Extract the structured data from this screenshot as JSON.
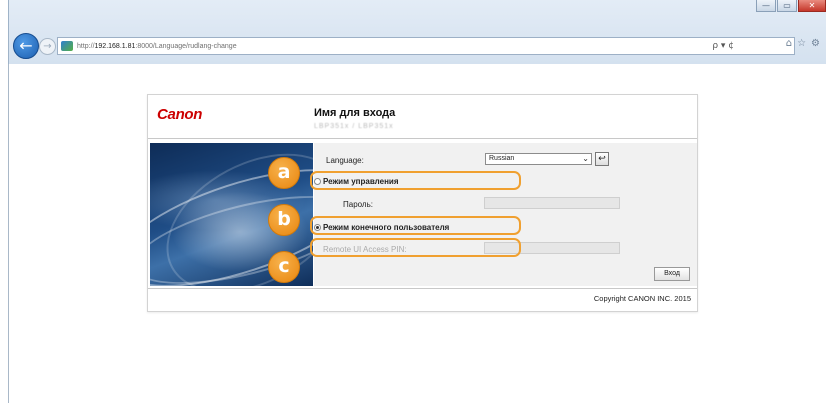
{
  "browser": {
    "url_prefix": "http://",
    "url_host": "192.168.1.81",
    "url_path": ":8000/Language/rudlang-change",
    "search_glyph": "ρ ▾ ¢",
    "window_buttons": [
      "—",
      "▭",
      "✕"
    ],
    "nav_icons": [
      "⌂",
      "☆",
      "⚙"
    ]
  },
  "page": {
    "logo_text": "Canon",
    "title": "Имя для входа",
    "device_name": "LBP351x / LBP351x",
    "form": {
      "language_label": "Language:",
      "language_selected": "Russian",
      "go_button_glyph": "↩",
      "admin_mode_label": "Режим управления",
      "password_label": "Пароль:",
      "user_mode_label": "Режим конечного пользователя",
      "pin_label": "Remote UI Access PIN:",
      "login_button": "Вход"
    },
    "copyright": "Copyright CANON INC. 2015"
  },
  "callouts": [
    {
      "letter": "a"
    },
    {
      "letter": "b"
    },
    {
      "letter": "c"
    }
  ],
  "colors": {
    "accent_orange": "#f0a030",
    "canon_red": "#cc0000",
    "browser_back": "#1c5fb0"
  }
}
